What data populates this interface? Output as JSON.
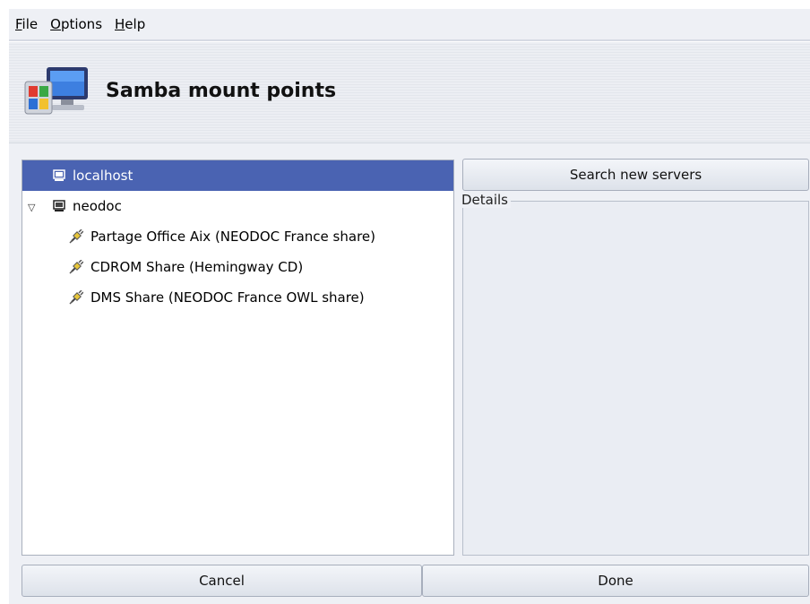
{
  "menu": {
    "items": [
      {
        "accel": "F",
        "rest": "ile"
      },
      {
        "accel": "O",
        "rest": "ptions"
      },
      {
        "accel": "H",
        "rest": "elp"
      }
    ]
  },
  "header": {
    "title": "Samba mount points",
    "icon": "network-computer-icon"
  },
  "tree": {
    "items": [
      {
        "label": "localhost",
        "icon": "computer-icon",
        "selected": true
      },
      {
        "label": "neodoc",
        "icon": "computer-icon",
        "expanded": true
      },
      {
        "label": "Partage Office Aix (NEODOC France share)",
        "icon": "share-plug-icon"
      },
      {
        "label": "CDROM Share (Hemingway CD)",
        "icon": "share-plug-icon"
      },
      {
        "label": "DMS Share (NEODOC France OWL share)",
        "icon": "share-plug-icon"
      }
    ]
  },
  "search_button": {
    "label": "Search new servers"
  },
  "details": {
    "label": "Details"
  },
  "buttons": {
    "cancel": "Cancel",
    "done": "Done"
  },
  "colors": {
    "selection": "#4a63b2",
    "window_bg": "#eef0f5"
  }
}
